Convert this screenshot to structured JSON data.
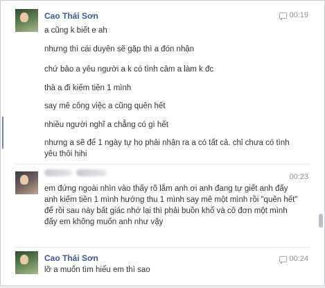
{
  "messages": [
    {
      "sender": "Cao Thái Sơn",
      "time": "00:19",
      "lines": [
        "a cũng k biết e ah",
        "nhưng thì cái duyên sẽ gặp thì a đón nhận",
        "chứ bảo a yêu người a k có tình cảm a làm k đc",
        "thà a đi kiếm tiền 1 mình",
        "say mê công việc a cũng quên hết",
        "nhiều người nghĩ a chẳng có gì hết",
        "nhưng a sẽ để 1 ngày tự họ phải nhận ra a có tất cả. chỉ chưa có tình yêu thôi hihi"
      ]
    },
    {
      "sender": "",
      "time": "00:23",
      "lines": [
        "em đứng ngoài nhìn vào thấy rõ lắm anh ơi anh đang tự giết anh đấy  anh kiếm tiền 1 mình hướng thu 1 mình say mê một mình rồi \"quên hết\" để rồi sau này bất giác nhớ lại thì phải buồn khổ và cô đơn một mình đấy em không muốn anh như vậy"
      ]
    },
    {
      "sender": "Cao Thái Sơn",
      "time": "00:24",
      "lines": [
        "lỡ a muốn tìm hiểu em thì sao"
      ]
    }
  ]
}
